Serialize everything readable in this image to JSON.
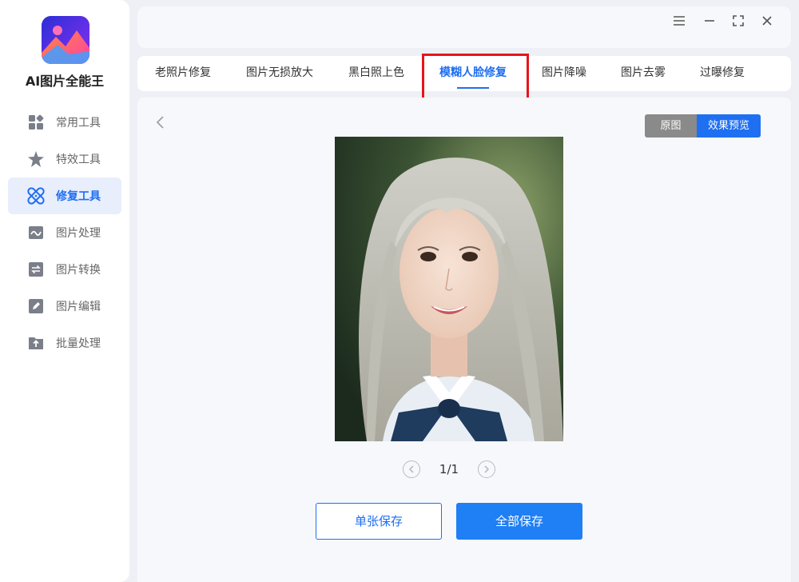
{
  "app": {
    "title": "AI图片全能王"
  },
  "sidebar": {
    "items": [
      {
        "label": "常用工具",
        "icon": "grid-icon"
      },
      {
        "label": "特效工具",
        "icon": "star-icon"
      },
      {
        "label": "修复工具",
        "icon": "bandage-icon",
        "active": true
      },
      {
        "label": "图片处理",
        "icon": "image-wave-icon"
      },
      {
        "label": "图片转换",
        "icon": "convert-icon"
      },
      {
        "label": "图片编辑",
        "icon": "edit-icon"
      },
      {
        "label": "批量处理",
        "icon": "upload-folder-icon"
      }
    ]
  },
  "tabs": [
    {
      "label": "老照片修复"
    },
    {
      "label": "图片无损放大"
    },
    {
      "label": "黑白照上色"
    },
    {
      "label": "模糊人脸修复",
      "active": true
    },
    {
      "label": "图片降噪"
    },
    {
      "label": "图片去雾"
    },
    {
      "label": "过曝修复"
    }
  ],
  "preview": {
    "toggle_original": "原图",
    "toggle_effect": "效果预览",
    "pager": "1/1"
  },
  "actions": {
    "save_single": "单张保存",
    "save_all": "全部保存"
  },
  "colors": {
    "accent": "#1f6ff2",
    "highlight_border": "#e8141b",
    "sidebar_active_bg": "#e8eefc"
  }
}
